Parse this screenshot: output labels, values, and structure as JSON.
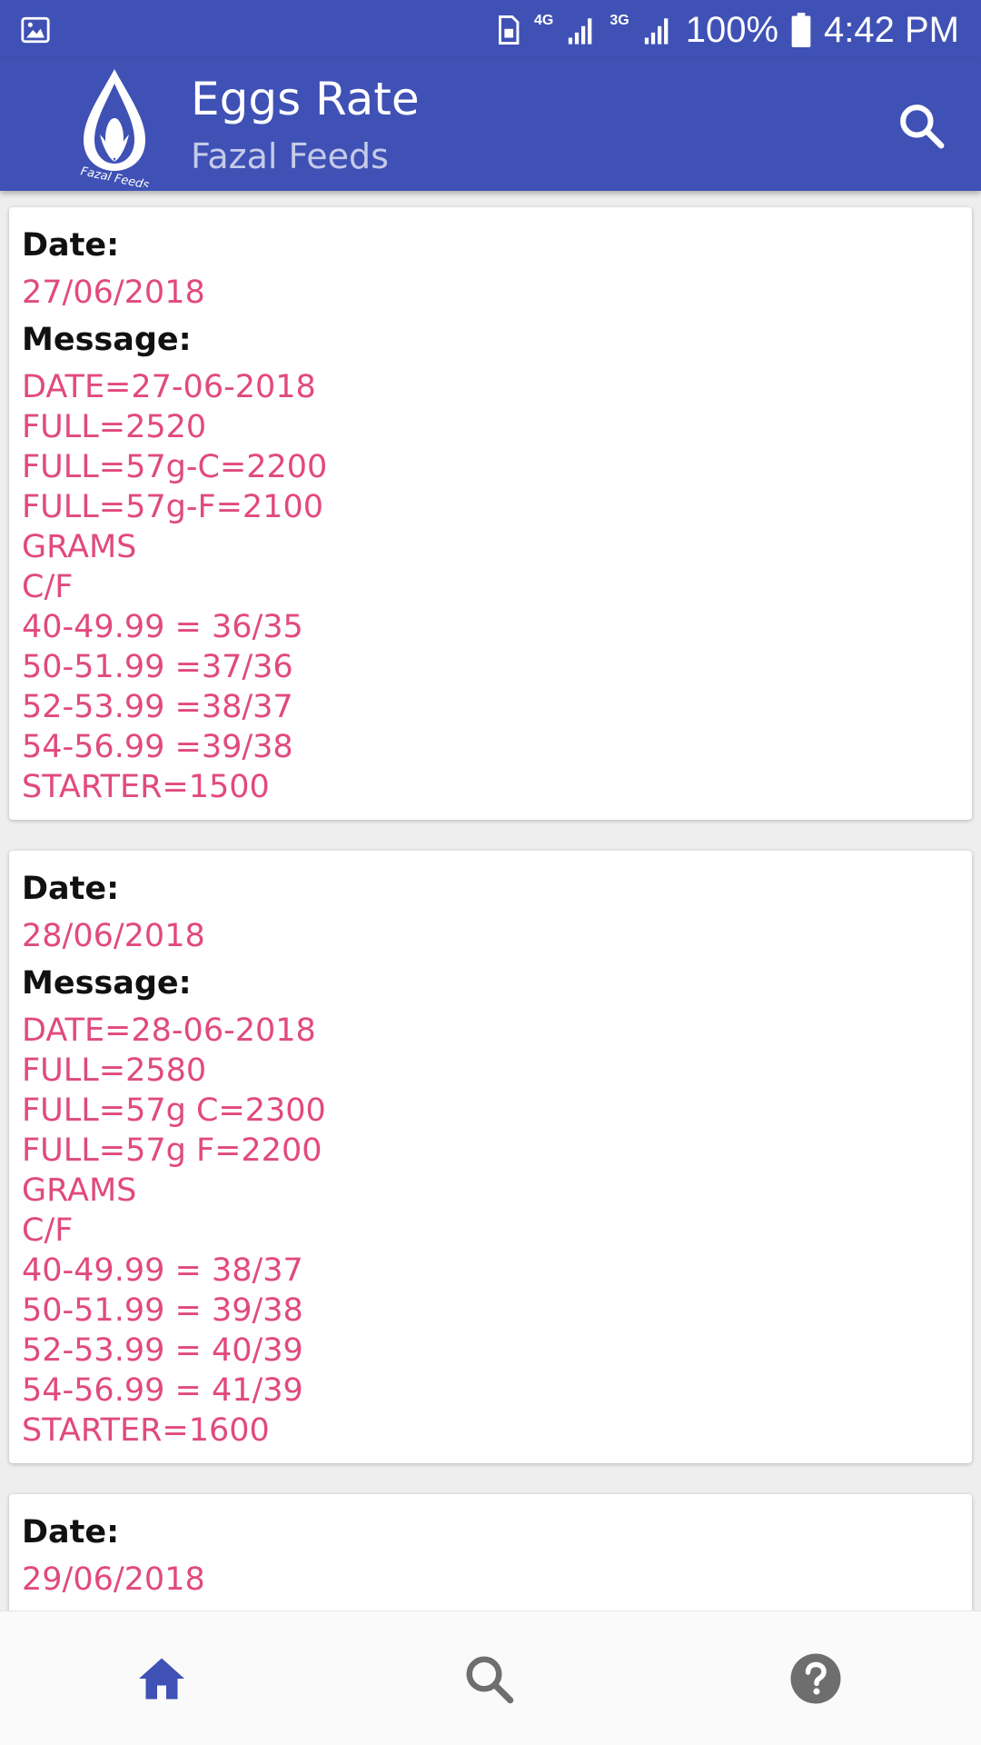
{
  "status_bar": {
    "battery": "100%",
    "time": "4:42 PM",
    "network_1": "4G",
    "network_2": "3G",
    "icons": [
      "image-icon",
      "sim-icon",
      "signal-icon",
      "battery-icon"
    ]
  },
  "app_bar": {
    "title": "Eggs Rate",
    "subtitle": "Fazal Feeds",
    "logo_text": "Fazal Feeds",
    "icons": [
      "logo-icon",
      "search-icon"
    ]
  },
  "labels": {
    "date": "Date:",
    "message": "Message:"
  },
  "cards": [
    {
      "date": "27/06/2018",
      "message": [
        "DATE=27-06-2018",
        "FULL=2520",
        "FULL=57g-C=2200",
        "FULL=57g-F=2100",
        "GRAMS",
        "C/F",
        "40-49.99 = 36/35",
        "50-51.99 =37/36",
        "52-53.99 =38/37",
        "54-56.99 =39/38",
        "STARTER=1500"
      ]
    },
    {
      "date": "28/06/2018",
      "message": [
        "DATE=28-06-2018",
        "FULL=2580",
        "FULL=57g C=2300",
        "FULL=57g F=2200",
        "GRAMS",
        "C/F",
        "40-49.99 = 38/37",
        "50-51.99 = 39/38",
        "52-53.99 = 40/39",
        "54-56.99 = 41/39",
        "STARTER=1600"
      ]
    },
    {
      "date": "29/06/2018",
      "message": []
    }
  ],
  "bottom_nav": {
    "items": [
      "home-icon",
      "search-icon",
      "help-icon"
    ],
    "active": "home-icon",
    "active_color": "#3f51b5",
    "inactive_color": "#6e6e6e"
  },
  "colors": {
    "primary": "#3f51b5",
    "accent_text": "#e14a7d"
  }
}
